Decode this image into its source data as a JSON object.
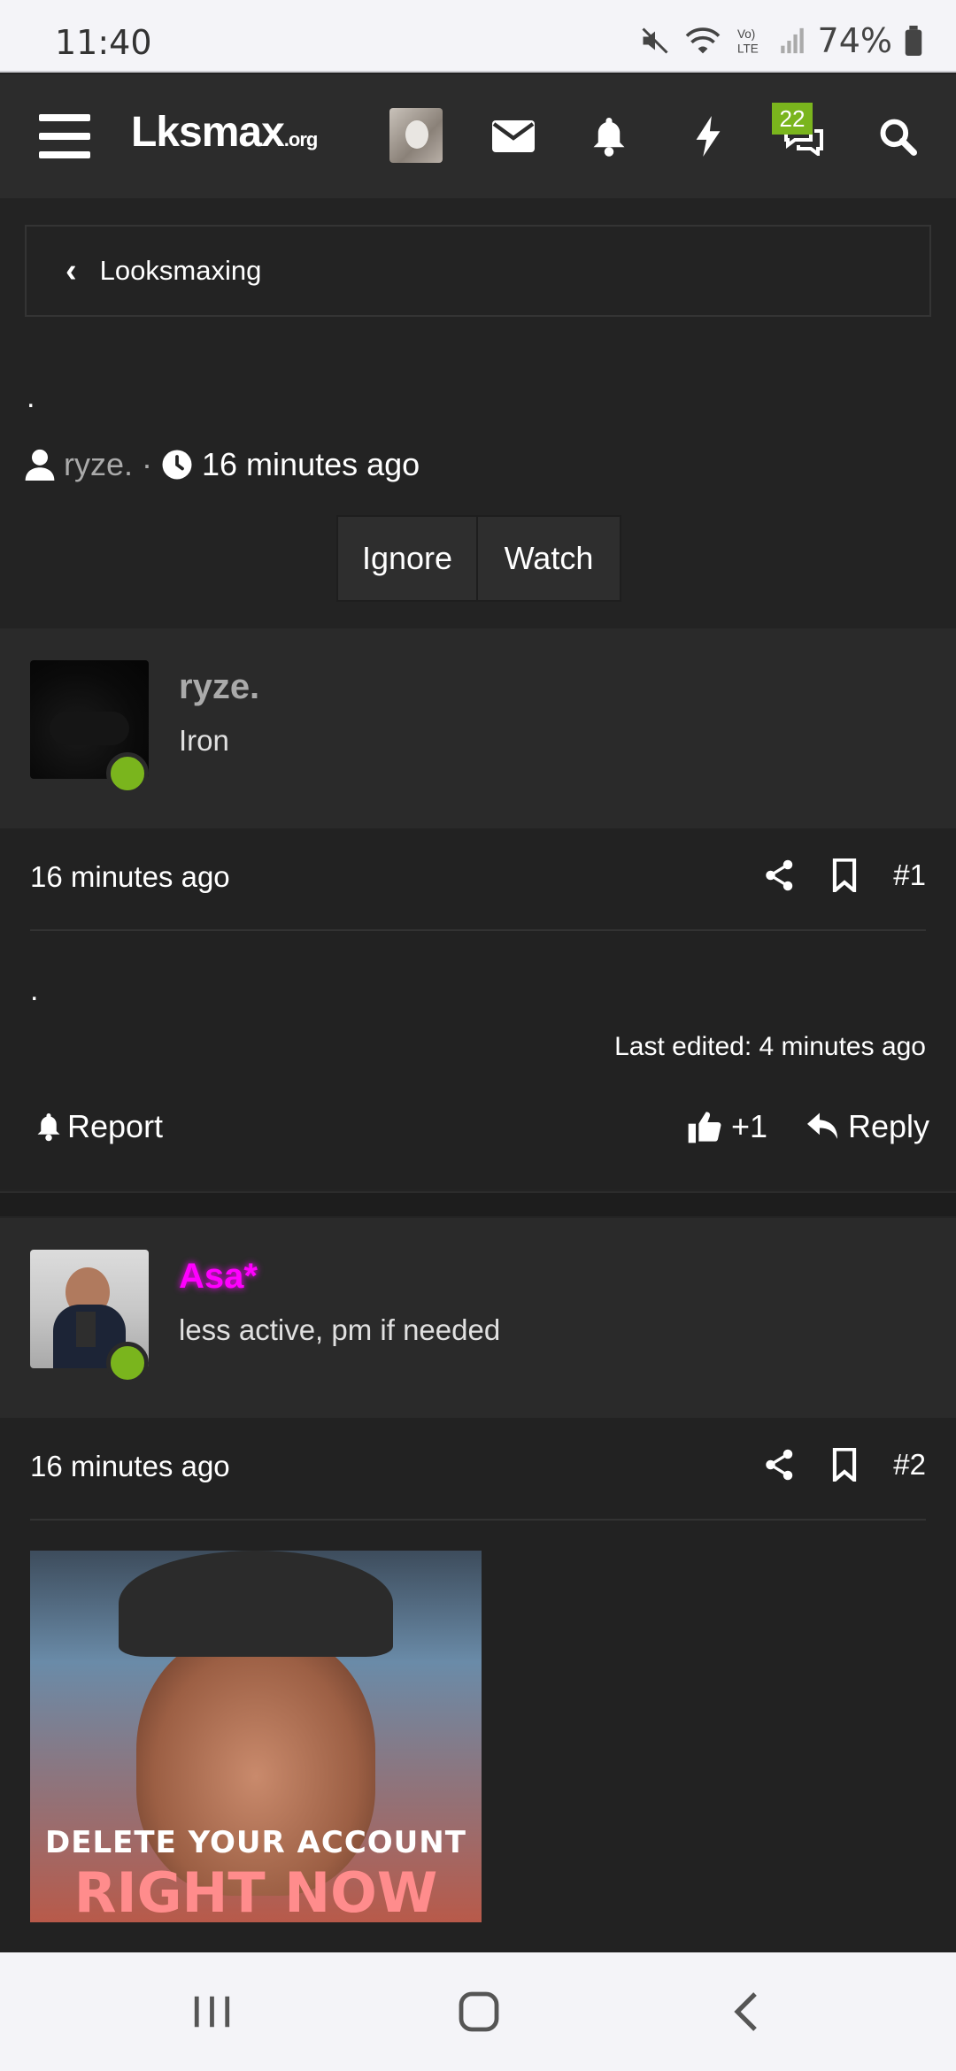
{
  "status": {
    "time": "11:40",
    "battery": "74%"
  },
  "header": {
    "logo_main": "Lksmax",
    "logo_suffix": ".org",
    "chat_badge": "22"
  },
  "breadcrumb": {
    "label": "Looksmaxing"
  },
  "thread": {
    "title": ".",
    "author": "ryze.",
    "time": "16 minutes ago",
    "ignore_label": "Ignore",
    "watch_label": "Watch"
  },
  "posts": [
    {
      "username": "ryze.",
      "username_color": "#aaaaaa",
      "user_title": "Iron",
      "time": "16 minutes ago",
      "number": "#1",
      "body": ".",
      "last_edited": "Last edited: 4 minutes ago",
      "report_label": "Report",
      "reaction": "+1",
      "reply_label": "Reply"
    },
    {
      "username": "Asa*",
      "username_color": "#ff00ff",
      "user_title": "less active, pm if needed",
      "time": "16 minutes ago",
      "number": "#2",
      "gif_line1": "DELETE YOUR ACCOUNT",
      "gif_line2": "RIGHT NOW"
    }
  ],
  "icons": [
    "menu-icon",
    "envelope-icon",
    "bell-icon",
    "bolt-icon",
    "chat-icon",
    "search-icon",
    "user-icon",
    "clock-icon",
    "share-icon",
    "bookmark-icon",
    "thumbs-up-icon",
    "reply-icon"
  ]
}
